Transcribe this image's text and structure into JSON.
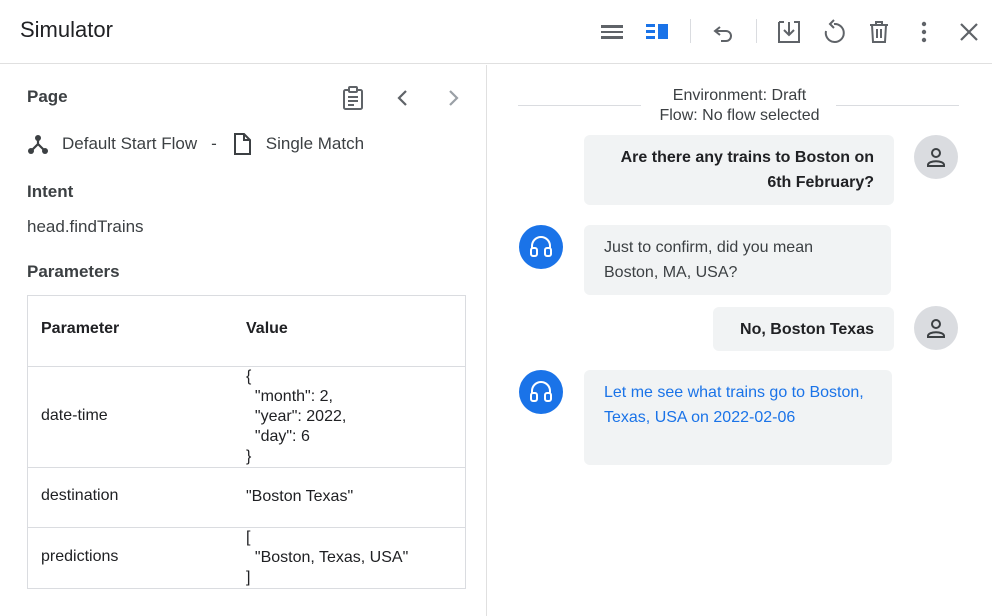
{
  "app": {
    "title": "Simulator"
  },
  "toolbar": {
    "icons": [
      "list-view-icon",
      "split-view-icon",
      "undo-icon",
      "export-icon",
      "reset-icon",
      "delete-icon",
      "more-vert-icon",
      "close-icon"
    ],
    "accent": "#1a73e8"
  },
  "left": {
    "page_heading": "Page",
    "flow_name": "Default Start Flow",
    "separator": "-",
    "page_name": "Single Match",
    "intent_heading": "Intent",
    "intent_value": "head.findTrains",
    "params_heading": "Parameters",
    "table": {
      "col_param": "Parameter",
      "col_value": "Value",
      "rows": [
        {
          "name": "date-time",
          "value": "{\n  \"month\": 2,\n  \"year\": 2022,\n  \"day\": 6\n}"
        },
        {
          "name": "destination",
          "value": "\"Boston Texas\""
        },
        {
          "name": "predictions",
          "value": "[\n  \"Boston, Texas, USA\"\n]"
        }
      ]
    }
  },
  "right": {
    "environment": "Environment: Draft",
    "flow": "Flow: No flow selected",
    "messages": [
      {
        "from": "user",
        "text": "Are there any trains to Boston on 6th February?"
      },
      {
        "from": "agent",
        "text": "Just to confirm, did you mean Boston, MA, USA?"
      },
      {
        "from": "user",
        "text": "No, Boston Texas"
      },
      {
        "from": "agent",
        "text": "Let me see what trains go to Boston, Texas, USA on 2022-02-06"
      }
    ]
  }
}
